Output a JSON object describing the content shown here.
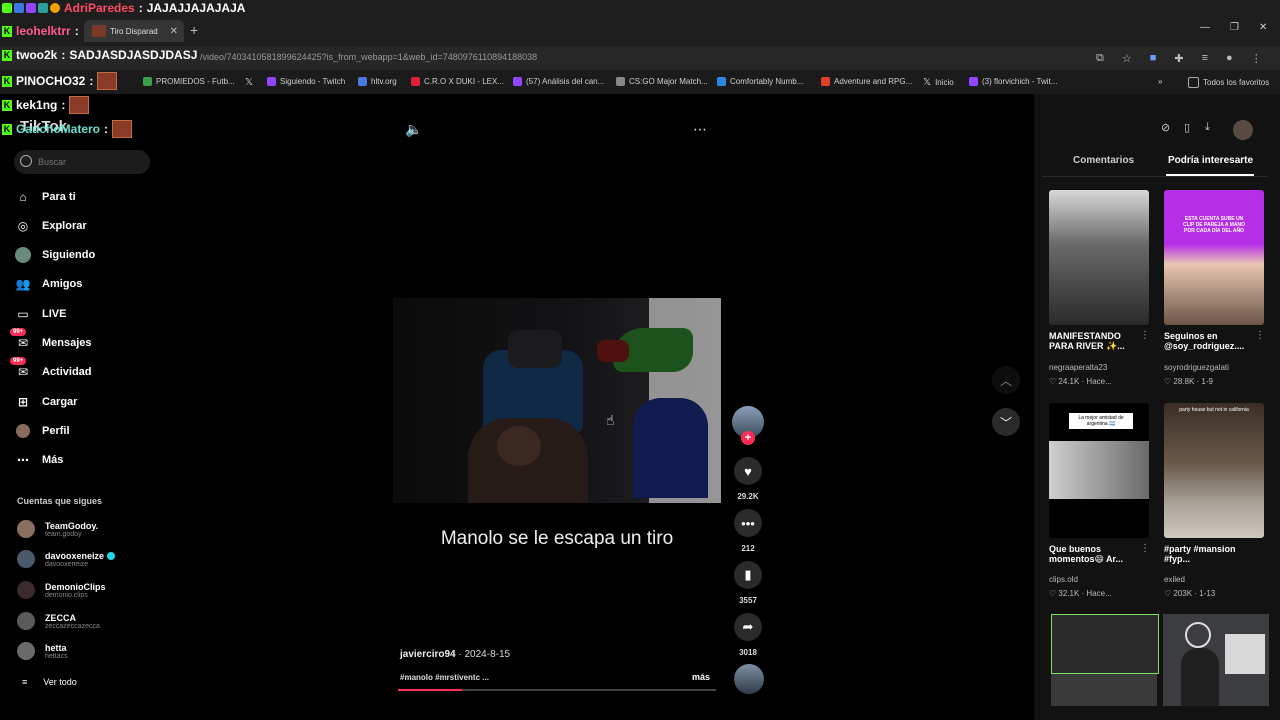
{
  "browser": {
    "tab_title": "Tiro Disparad",
    "url": "/video/7403410581899624425?is_from_webapp=1&web_id=7480976110894188038",
    "bookmarks": [
      "PROMIEDOS - Futb...",
      "Siguiendo - Twitch",
      "hltv.org",
      "C.R.O X DUKI - LEX...",
      "(57) Análisis del can...",
      "CS:GO Major Match...",
      "Comfortably Numb...",
      "Adventure and RPG...",
      "Inicio",
      "(3) florvichich - Twit..."
    ],
    "all_favorites": "Todos los favoritos"
  },
  "chat": [
    {
      "user": "AdriParedes",
      "color": "#ff4a6a",
      "message": "JAJAJJAJAJAJA"
    },
    {
      "user": "leohelktrr",
      "color": "#ff5a8a",
      "message": ""
    },
    {
      "user": "twoo2k",
      "color": "#ffffff",
      "message": "SADJASDJASDJDASJ"
    },
    {
      "user": "PINOCHO32",
      "color": "#ffffff",
      "message": ""
    },
    {
      "user": "kek1ng",
      "color": "#ffffff",
      "message": ""
    },
    {
      "user": "GauchoMatero",
      "color": "#6adfd0",
      "message": ""
    }
  ],
  "sidebar": {
    "logo": "TikTok",
    "search_placeholder": "Buscar",
    "nav": [
      "Para ti",
      "Explorar",
      "Siguiendo",
      "Amigos",
      "LIVE",
      "Mensajes",
      "Actividad",
      "Cargar",
      "Perfil",
      "Más"
    ],
    "badge": "99+",
    "following_header": "Cuentas que sigues",
    "following": [
      {
        "name": "TeamGodoy.",
        "handle": "team.godoy"
      },
      {
        "name": "davooxeneize",
        "handle": "davooxeneize"
      },
      {
        "name": "DemonioClips",
        "handle": "demonio.clips"
      },
      {
        "name": "ZECCA",
        "handle": "zeccazeccazecca"
      },
      {
        "name": "hetta",
        "handle": "hettacs"
      }
    ],
    "see_all": "Ver todo"
  },
  "video": {
    "caption_overlay": "Manolo se le escapa un tiro",
    "author": "javierciro94",
    "date": "2024-8-15",
    "tags": "#manolo #mrstiventc ...",
    "more": "más",
    "progress": 0.2,
    "likes": "29.2K",
    "comments": "212",
    "saves": "3557",
    "shares": "3018"
  },
  "right_panel": {
    "tabs": [
      "Comentarios",
      "Podría interesarte"
    ],
    "cards": [
      {
        "title": "MANIFESTANDO PARA RIVER ✨...",
        "user": "negraaperalta23",
        "stats": "24.1K · Hace..."
      },
      {
        "title": "Seguinos en @soy_rodriguez....",
        "user": "soyrodriguezgalati",
        "stats": "28.8K · 1-9"
      },
      {
        "title": "Que buenos momentos😄 Ar...",
        "user": "clips.old",
        "stats": "32.1K · Hace..."
      },
      {
        "title": "#party #mansion #fyp...",
        "user": "exiled",
        "stats": "203K · 1-13"
      }
    ],
    "thumb_texts": [
      "ESTA CUENTA SUBE UN CLIP DE PAREJA A MANO POR CADA DÍA DEL AÑO",
      "La mejor amistad de argentina 🇦🇷",
      "party house but not in california"
    ]
  },
  "colors": {
    "accent": "#fe2c55",
    "kick_green": "#53fc18",
    "panel": "#121212"
  }
}
